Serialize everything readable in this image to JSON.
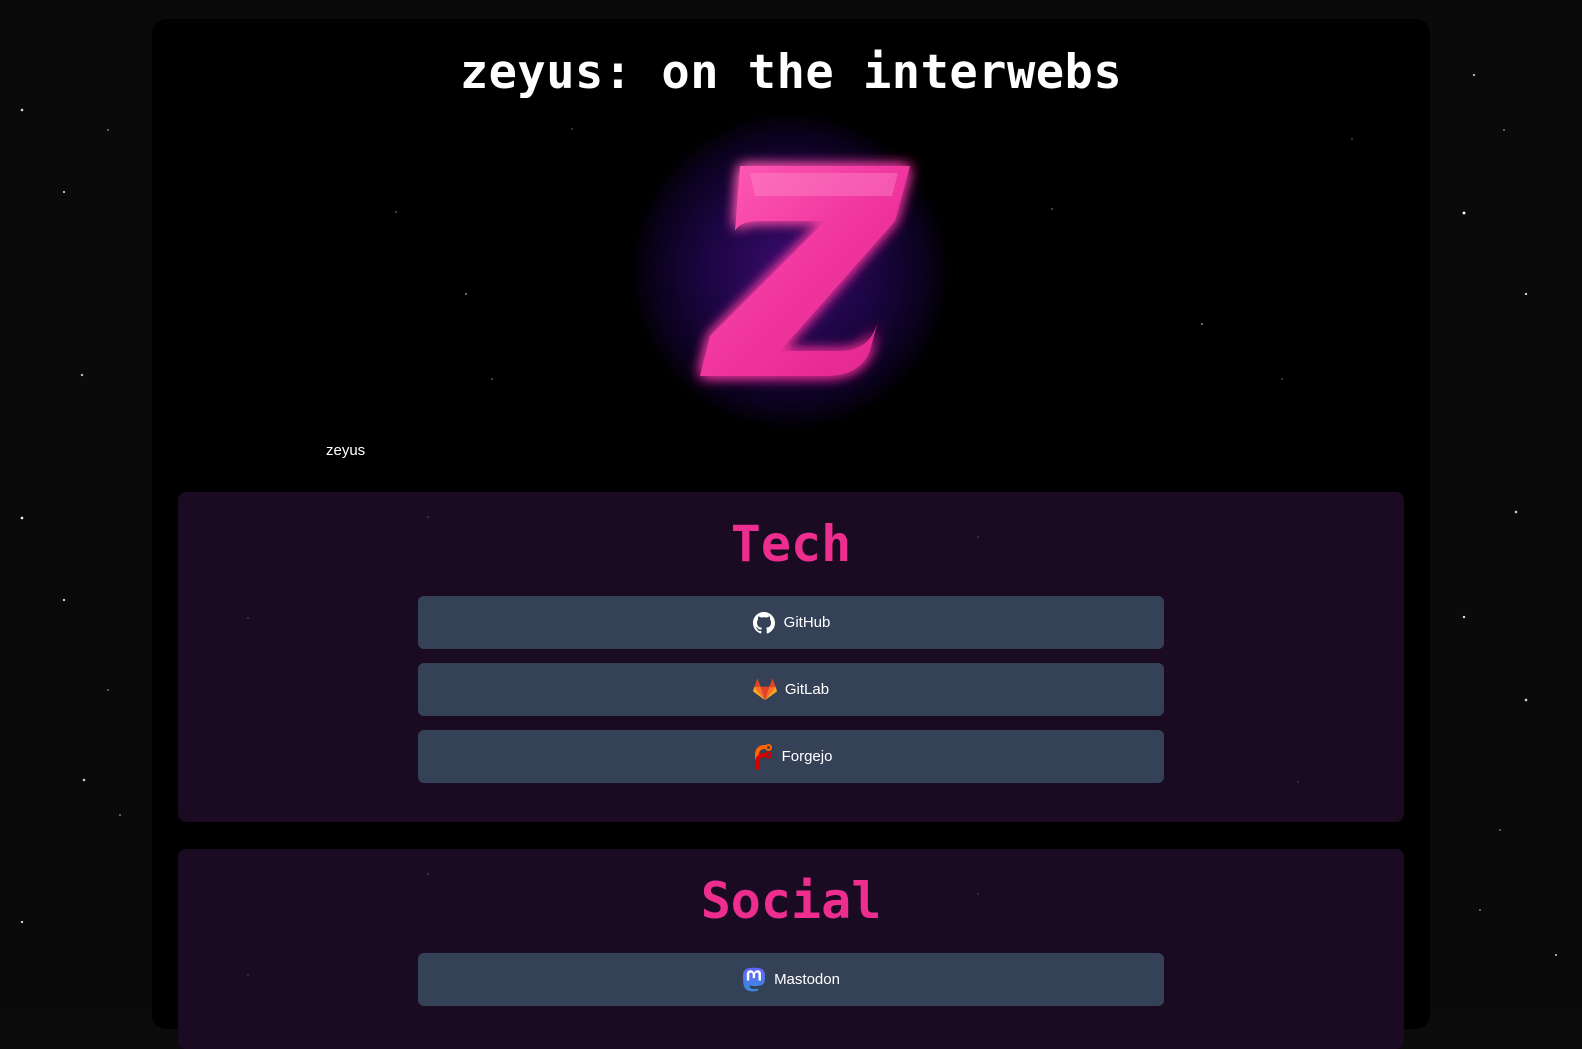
{
  "page": {
    "title": "zeyus: on the interwebs",
    "avatar_name": "zeyus"
  },
  "sections": [
    {
      "title": "Tech",
      "links": [
        {
          "label": "GitHub",
          "icon": "github-icon"
        },
        {
          "label": "GitLab",
          "icon": "gitlab-icon"
        },
        {
          "label": "Forgejo",
          "icon": "forgejo-icon"
        }
      ]
    },
    {
      "title": "Social",
      "links": [
        {
          "label": "Mastodon",
          "icon": "mastodon-icon"
        }
      ]
    }
  ],
  "colors": {
    "accent_pink": "#ee2e8f",
    "section_bg": "#1a0a22",
    "button_bg": "#344156",
    "card_bg": "#000000"
  }
}
